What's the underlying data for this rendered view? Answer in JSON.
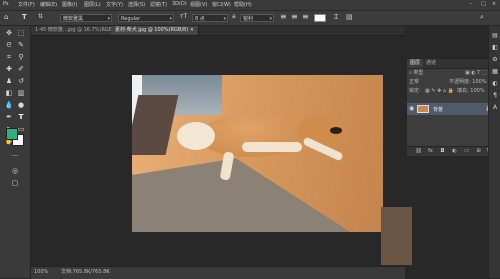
{
  "menu": [
    "文件(F)",
    "编辑(E)",
    "图像(I)",
    "图层(L)",
    "文字(Y)",
    "选择(S)",
    "滤镜(T)",
    "3D(D)",
    "视图(V)",
    "窗口(W)",
    "帮助(H)"
  ],
  "options": {
    "font_family": "微软雅黑",
    "font_style": "Regular",
    "font_size": "8 点",
    "aa_label": "a",
    "aa_mode": "锐利"
  },
  "tabs": [
    "1-45 微软雅...jpg @ 16.7%(RGB/8) ×",
    "素材-柴犬.jpg @ 100%(RGB/8) ×"
  ],
  "status": {
    "zoom": "100%",
    "doc": "文档:765.8K/765.8K"
  },
  "layers_panel": {
    "tabs": [
      "图层",
      "通道"
    ],
    "kind_label": "类型",
    "mode": "正常",
    "opacity_label": "不透明度: 100%",
    "lock_label": "锁定:",
    "fill_label": "填充: 100%",
    "layer_name": "背景"
  },
  "colors": {
    "foreground": "#2fb07a",
    "background": "#ffffff",
    "accent": "#4a8ad4"
  },
  "icons": {
    "tools": [
      "move-icon",
      "marquee-icon",
      "lasso-icon",
      "quick-select-icon",
      "crop-icon",
      "eyedropper-icon",
      "healing-icon",
      "brush-icon",
      "stamp-icon",
      "history-brush-icon",
      "eraser-icon",
      "gradient-icon",
      "blur-icon",
      "dodge-icon",
      "pen-icon",
      "type-icon",
      "path-select-icon",
      "rectangle-icon",
      "hand-icon",
      "zoom-icon"
    ]
  }
}
